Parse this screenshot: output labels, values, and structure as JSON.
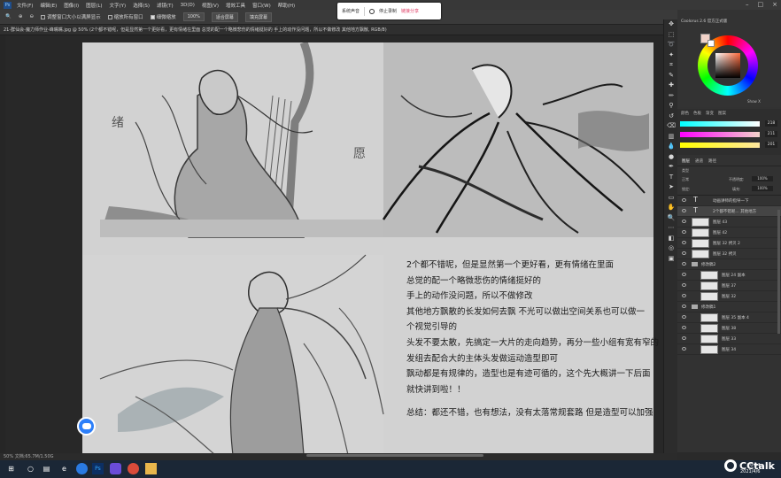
{
  "menubar": {
    "logo": "Ps",
    "items": [
      "文件(F)",
      "编辑(E)",
      "图像(I)",
      "图层(L)",
      "文字(Y)",
      "选择(S)",
      "滤镜(T)",
      "3D(D)",
      "视图(V)",
      "增效工具",
      "窗口(W)",
      "帮助(H)"
    ]
  },
  "options": {
    "zoom_tool": "🔍",
    "resize_windows": "调整窗口大小以满屏显示",
    "zoom_all": "缩放所有窗口",
    "scrubby_zoom": "细微缩放",
    "zoom_value": "100%",
    "fit_screen": "适合屏幕",
    "fill_screen": "填充屏幕"
  },
  "recorder": {
    "audio": "系统声音",
    "stop": "停止录制",
    "share": "链接分享"
  },
  "document": {
    "tab": "21-群仙会-魔力师作业-峰嘴嘴.jpg @ 50% (2个都不错呢，但是显然第一个更好看，更有情绪在里面 总觉的配一个略微悲伤的情绪挺好的 手上的动作没问题，所以不做修改 其他地方飘散, RGB/8)"
  },
  "notes": {
    "lines": [
      "2个都不错呢，但是显然第一个更好看，更有情绪在里面",
      "总觉的配一个略微悲伤的情绪挺好的",
      "手上的动作没问题，所以不做修改",
      "其他地方飘散的长发如何去飘 不光可以做出空间关系也可以做一",
      "个视觉引导的",
      "头发不要太散，先搞定一大片的走向趋势，再分一些小组有宽有窄的",
      "发组去配合大的主体头发做运动造型即可",
      "飘动都是有规律的，造型也是有迹可循的，这个先大概讲一下后面",
      "就快讲到啦！！"
    ],
    "summary": "总结：都还不错，也有想法，没有太落常规套路   但是造型可以加强"
  },
  "sketch_marks": {
    "left": "绪",
    "right": "愿"
  },
  "status": {
    "zoom": "50%",
    "info": "文档:65.7M/1.50G"
  },
  "color_panel": {
    "title": "Coolorus 2.6 官方正式版",
    "hex": "f2d3c9",
    "label": "Show X"
  },
  "sliders": {
    "tabs": [
      "颜色",
      "色板",
      "渐变",
      "图案"
    ],
    "values": [
      "218",
      "211",
      "201"
    ]
  },
  "layers": {
    "tabs": [
      "图层",
      "通道",
      "路径"
    ],
    "kind": "类型",
    "blend": "正常",
    "opacity_label": "不透明度:",
    "opacity": "100%",
    "lock_label": "锁定:",
    "fill_label": "填充:",
    "fill": "100%",
    "rows": [
      {
        "type": "text",
        "name": "动画讲师的指导一下"
      },
      {
        "type": "text",
        "name": "2个都不错呢... 其他地方"
      },
      {
        "type": "layer",
        "name": "图层 43"
      },
      {
        "type": "layer",
        "name": "图层 42"
      },
      {
        "type": "layer",
        "name": "图层 32 拷贝 2"
      },
      {
        "type": "layer",
        "name": "图层 32 拷贝"
      },
      {
        "type": "folder",
        "name": "修改稿2"
      },
      {
        "type": "layer",
        "name": "图层 24 副本",
        "indent": true
      },
      {
        "type": "layer",
        "name": "图层 37",
        "indent": true
      },
      {
        "type": "layer",
        "name": "图层 32",
        "indent": true
      },
      {
        "type": "folder",
        "name": "修改稿1"
      },
      {
        "type": "layer",
        "name": "图层 35 副本 4",
        "indent": true
      },
      {
        "type": "layer",
        "name": "图层 38",
        "indent": true
      },
      {
        "type": "layer",
        "name": "图层 33",
        "indent": true
      },
      {
        "type": "layer",
        "name": "图层 34",
        "indent": true
      }
    ]
  },
  "taskbar": {
    "time": "20:54",
    "date": "2021/4/6",
    "cctalk": "CCtalk"
  }
}
